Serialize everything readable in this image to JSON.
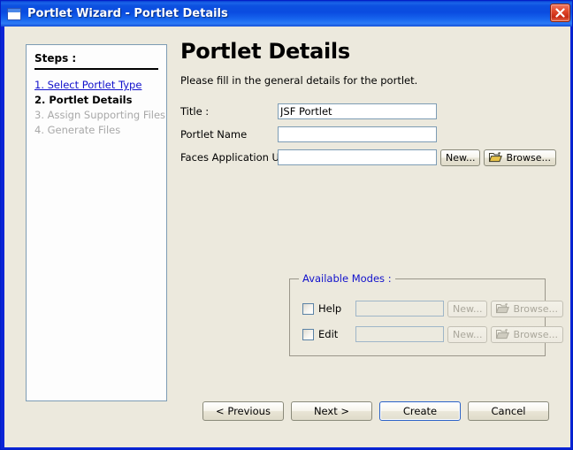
{
  "window": {
    "title": "Portlet Wizard - Portlet Details",
    "icon": "window-icon",
    "close_icon": "close-icon",
    "background_color": "#ece9dd",
    "titlebar_color": "#0a4ce0",
    "accent_color": "#1111cc"
  },
  "steps_panel": {
    "heading": "Steps :",
    "items": [
      {
        "label": "1. Select Portlet Type",
        "state": "link"
      },
      {
        "label": "2. Portlet Details",
        "state": "current"
      },
      {
        "label": "3. Assign Supporting Files",
        "state": "future"
      },
      {
        "label": "4. Generate Files",
        "state": "future"
      }
    ]
  },
  "main": {
    "title": "Portlet Details",
    "subtitle": "Please fill in the general details for the portlet.",
    "fields": [
      {
        "label": "Title :",
        "value": "JSF Portlet",
        "placeholder": ""
      },
      {
        "label": "Portlet Name",
        "value": "",
        "placeholder": ""
      },
      {
        "label": "Faces Application URL",
        "value": "",
        "placeholder": ""
      }
    ],
    "url_buttons": {
      "new_label": "New...",
      "browse_label": "Browse...",
      "browse_icon": "folder-icon"
    }
  },
  "available_modes": {
    "legend": "Available Modes :",
    "rows": [
      {
        "label": "Help",
        "checked": false,
        "value": "",
        "new_label": "New...",
        "browse_label": "Browse...",
        "browse_icon": "folder-icon",
        "enabled": false
      },
      {
        "label": "Edit",
        "checked": false,
        "value": "",
        "new_label": "New...",
        "browse_label": "Browse...",
        "browse_icon": "folder-icon",
        "enabled": false
      }
    ]
  },
  "footer": {
    "previous_label": "< Previous",
    "next_label": "Next >",
    "create_label": "Create",
    "cancel_label": "Cancel",
    "default_button": "Create"
  }
}
